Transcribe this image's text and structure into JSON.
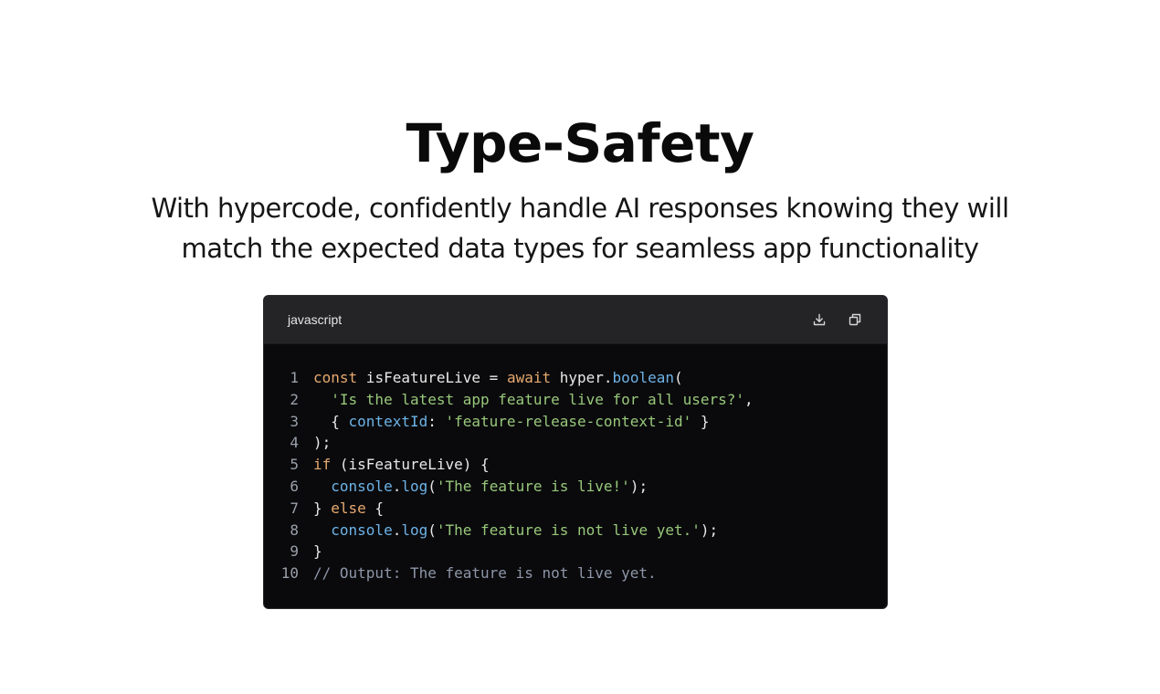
{
  "hero": {
    "title": "Type-Safety",
    "subtitle": "With hypercode, confidently handle AI responses knowing they will match the expected data types for seamless app functionality"
  },
  "code_block": {
    "language": "javascript",
    "actions": [
      {
        "name": "download",
        "icon": "download-icon"
      },
      {
        "name": "copy",
        "icon": "copy-icon"
      }
    ],
    "colors": {
      "background": "#0a0a0c",
      "header": "#242427",
      "keyword": "#e7a96f",
      "function": "#6db3e8",
      "string": "#98c87b",
      "comment": "#8d96a8",
      "plain": "#e8e8e8",
      "line_number": "#9aa0aa"
    },
    "lines": [
      {
        "n": "1",
        "tokens": [
          {
            "t": "kw",
            "v": "const"
          },
          {
            "t": "pl",
            "v": " isFeatureLive = "
          },
          {
            "t": "kw",
            "v": "await"
          },
          {
            "t": "pl",
            "v": " hyper."
          },
          {
            "t": "fn",
            "v": "boolean"
          },
          {
            "t": "pl",
            "v": "("
          }
        ]
      },
      {
        "n": "2",
        "tokens": [
          {
            "t": "pl",
            "v": "  "
          },
          {
            "t": "str",
            "v": "'Is the latest app feature live for all users?'"
          },
          {
            "t": "pl",
            "v": ","
          }
        ]
      },
      {
        "n": "3",
        "tokens": [
          {
            "t": "pl",
            "v": "  { "
          },
          {
            "t": "fn",
            "v": "contextId"
          },
          {
            "t": "pl",
            "v": ": "
          },
          {
            "t": "str",
            "v": "'feature-release-context-id'"
          },
          {
            "t": "pl",
            "v": " }"
          }
        ]
      },
      {
        "n": "4",
        "tokens": [
          {
            "t": "pl",
            "v": ");"
          }
        ]
      },
      {
        "n": "5",
        "tokens": [
          {
            "t": "kw",
            "v": "if"
          },
          {
            "t": "pl",
            "v": " (isFeatureLive) {"
          }
        ]
      },
      {
        "n": "6",
        "tokens": [
          {
            "t": "pl",
            "v": "  "
          },
          {
            "t": "fn",
            "v": "console"
          },
          {
            "t": "pl",
            "v": "."
          },
          {
            "t": "fn",
            "v": "log"
          },
          {
            "t": "pl",
            "v": "("
          },
          {
            "t": "str",
            "v": "'The feature is live!'"
          },
          {
            "t": "pl",
            "v": ");"
          }
        ]
      },
      {
        "n": "7",
        "tokens": [
          {
            "t": "pl",
            "v": "} "
          },
          {
            "t": "kw",
            "v": "else"
          },
          {
            "t": "pl",
            "v": " {"
          }
        ]
      },
      {
        "n": "8",
        "tokens": [
          {
            "t": "pl",
            "v": "  "
          },
          {
            "t": "fn",
            "v": "console"
          },
          {
            "t": "pl",
            "v": "."
          },
          {
            "t": "fn",
            "v": "log"
          },
          {
            "t": "pl",
            "v": "("
          },
          {
            "t": "str",
            "v": "'The feature is not live yet.'"
          },
          {
            "t": "pl",
            "v": ");"
          }
        ]
      },
      {
        "n": "9",
        "tokens": [
          {
            "t": "pl",
            "v": "}"
          }
        ]
      },
      {
        "n": "10",
        "tokens": [
          {
            "t": "cm",
            "v": "// Output: The feature is not live yet."
          }
        ]
      }
    ]
  }
}
